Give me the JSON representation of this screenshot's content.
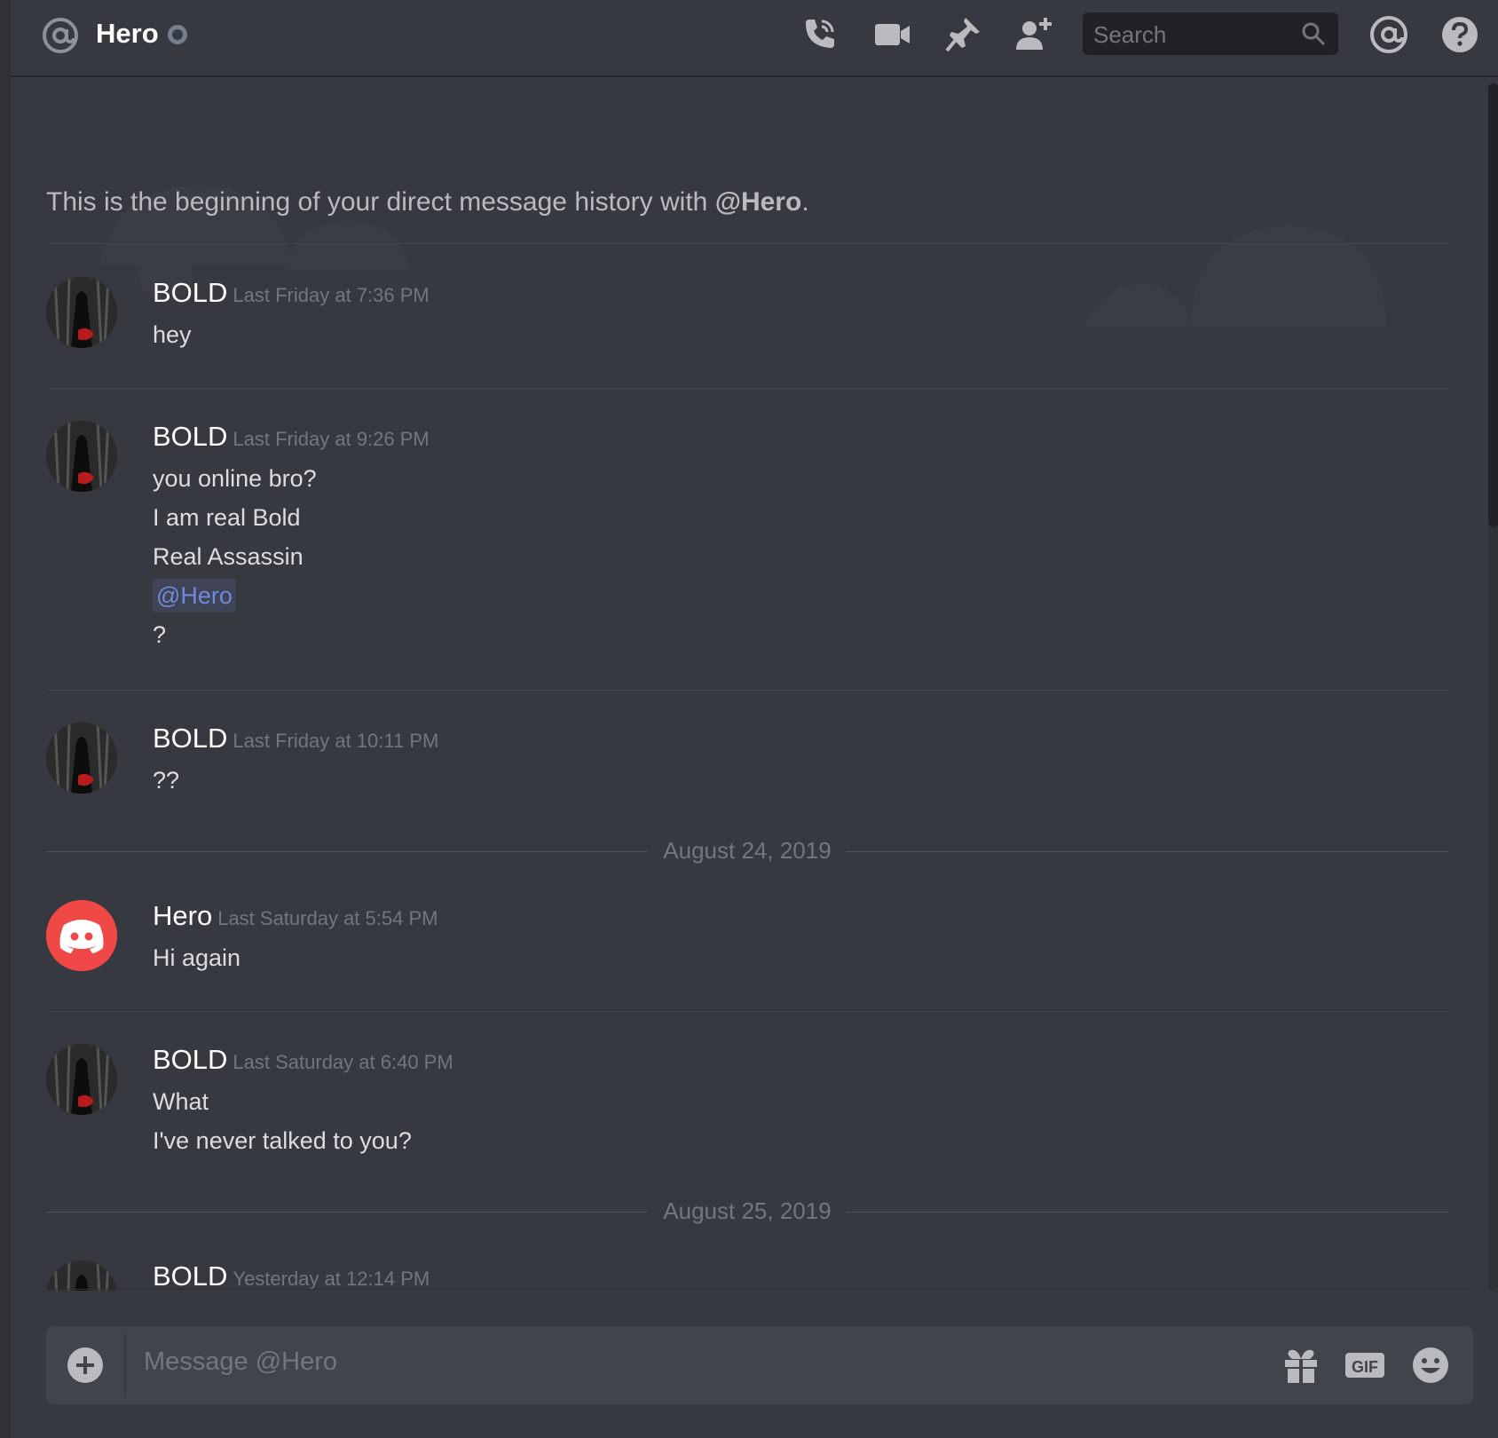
{
  "header": {
    "title": "Hero",
    "search_placeholder": "Search"
  },
  "welcome": {
    "prefix": "This is the beginning of your direct message history with ",
    "handle": "@Hero",
    "suffix": "."
  },
  "messages": [
    {
      "author": "BOLD",
      "time": "Last Friday at 7:36 PM",
      "lines": [
        "hey"
      ]
    },
    {
      "author": "BOLD",
      "time": "Last Friday at 9:26 PM",
      "lines": [
        "you online bro?",
        "I am real Bold",
        "Real Assassin",
        "@Hero",
        "?"
      ]
    },
    {
      "author": "BOLD",
      "time": "Last Friday at 10:11 PM",
      "lines": [
        "??"
      ]
    },
    {
      "author": "Hero",
      "time": "Last Saturday at 5:54 PM",
      "lines": [
        "Hi again"
      ]
    },
    {
      "author": "BOLD",
      "time": "Last Saturday at 6:40 PM",
      "lines": [
        "What",
        "I've never talked to you?"
      ]
    },
    {
      "author": "BOLD",
      "time": "Yesterday at 12:14 PM",
      "lines": []
    }
  ],
  "date_dividers": [
    "August 24, 2019",
    "August 25, 2019"
  ],
  "composer": {
    "placeholder": "Message @Hero"
  },
  "colors": {
    "background": "#36393f",
    "header_text": "#ffffff",
    "mention": "#7289da",
    "hero_avatar": "#f04747"
  },
  "icons": {
    "header": [
      "at-icon",
      "call-icon",
      "video-icon",
      "pin-icon",
      "add-friend-icon",
      "search-icon",
      "mentions-icon",
      "help-icon"
    ],
    "composer": [
      "plus-icon",
      "gift-icon",
      "gif-icon",
      "emoji-icon"
    ]
  }
}
